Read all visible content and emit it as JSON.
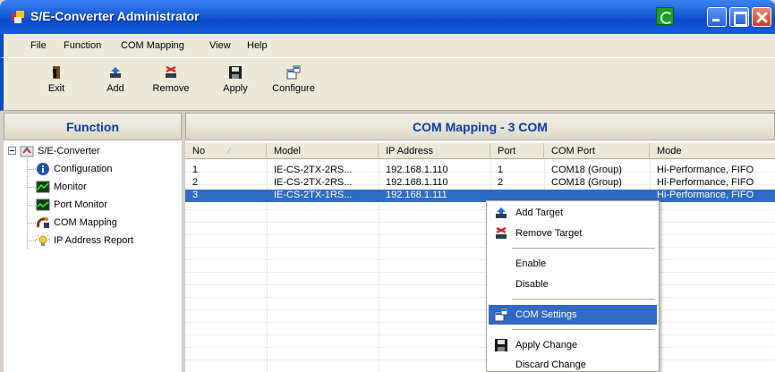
{
  "window": {
    "title": "S/E-Converter Administrator"
  },
  "menu": [
    "File",
    "Function",
    "COM Mapping",
    "View",
    "Help"
  ],
  "toolbar": {
    "exit": "Exit",
    "add": "Add",
    "remove": "Remove",
    "apply": "Apply",
    "configure": "Configure"
  },
  "left": {
    "title": "Function",
    "tree": {
      "root": "S/E-Converter",
      "children": [
        "Configuration",
        "Monitor",
        "Port Monitor",
        "COM Mapping",
        "IP Address Report"
      ]
    }
  },
  "right": {
    "title": "COM Mapping - 3 COM",
    "columns": [
      "No",
      "Model",
      "IP Address",
      "Port",
      "COM Port",
      "Mode"
    ],
    "rows": [
      {
        "no": "1",
        "model": "IE-CS-2TX-2RS...",
        "ip": "192.168.1.110",
        "port": "1",
        "com": "COM18 (Group)",
        "mode": "Hi-Performance, FIFO"
      },
      {
        "no": "2",
        "model": "IE-CS-2TX-2RS...",
        "ip": "192.168.1.110",
        "port": "2",
        "com": "COM18 (Group)",
        "mode": "Hi-Performance, FIFO"
      },
      {
        "no": "3",
        "model": "IE-CS-2TX-1RS...",
        "ip": "192.168.1.111",
        "port": "",
        "com": "",
        "mode": "Hi-Performance, FIFO"
      }
    ]
  },
  "context_menu": {
    "add_target": "Add Target",
    "remove_target": "Remove Target",
    "enable": "Enable",
    "disable": "Disable",
    "com_settings": "COM Settings",
    "apply_change": "Apply Change",
    "discard_change": "Discard Change"
  },
  "colors": {
    "title_bar": "#0a49c7",
    "selection": "#316ac5",
    "header_text": "#0a3ba3"
  }
}
